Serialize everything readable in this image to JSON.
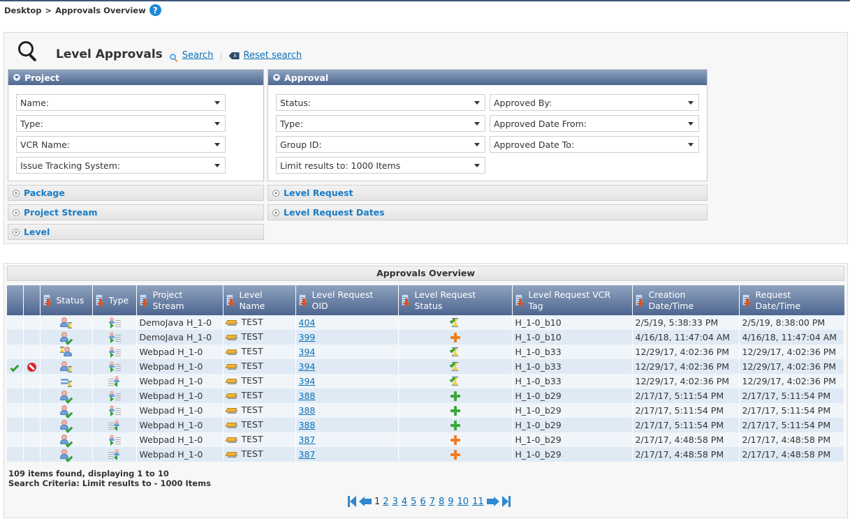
{
  "breadcrumb": {
    "root": "Desktop",
    "separator": ">",
    "current": "Approvals Overview"
  },
  "search": {
    "title": "Level Approvals",
    "search_link": "Search",
    "reset_link": "Reset search",
    "sections": {
      "project": {
        "title": "Project",
        "fields": [
          "Name:",
          "Type:",
          "VCR Name:",
          "Issue Tracking System:"
        ]
      },
      "approval": {
        "title": "Approval",
        "left_fields": [
          "Status:",
          "Type:",
          "Group ID:",
          "Limit results to: 1000 Items"
        ],
        "right_fields": [
          "Approved By:",
          "Approved Date From:",
          "Approved Date To:"
        ]
      },
      "collapsed": [
        "Package",
        "Level Request",
        "Project Stream",
        "Level Request Dates",
        "Level"
      ]
    }
  },
  "results": {
    "title": "Approvals Overview",
    "columns": [
      "",
      "",
      "Status",
      "Type",
      "Project Stream",
      "Level Name",
      "Level Request OID",
      "Level Request Status",
      "Level Request VCR Tag",
      "Creation Date/Time",
      "Request Date/Time"
    ],
    "rows": [
      {
        "actions": false,
        "status_icon": "pending",
        "type_icon": "request",
        "stream": "DemoJava H_1-0",
        "level": "TEST",
        "oid": "404",
        "lr_status_icon": "pending-approval",
        "tag": "H_1-0_b10",
        "created": "2/5/19, 5:38:33 PM",
        "requested": "2/5/19, 8:38:00 PM"
      },
      {
        "actions": false,
        "status_icon": "approved",
        "type_icon": "request",
        "stream": "DemoJava H_1-0",
        "level": "TEST",
        "oid": "399",
        "lr_status_icon": "orange-plus",
        "tag": "H_1-0_b10",
        "created": "4/16/18, 11:47:04 AM",
        "requested": "4/16/18, 11:47:04 AM"
      },
      {
        "actions": false,
        "status_icon": "group-pending",
        "type_icon": "request",
        "stream": "Webpad H_1-0",
        "level": "TEST",
        "oid": "394",
        "lr_status_icon": "pending-approval",
        "tag": "H_1-0_b33",
        "created": "12/29/17, 4:02:36 PM",
        "requested": "12/29/17, 4:02:36 PM"
      },
      {
        "actions": true,
        "status_icon": "pending",
        "type_icon": "request",
        "stream": "Webpad H_1-0",
        "level": "TEST",
        "oid": "394",
        "lr_status_icon": "pending-approval",
        "tag": "H_1-0_b33",
        "created": "12/29/17, 4:02:36 PM",
        "requested": "12/29/17, 4:02:36 PM"
      },
      {
        "actions": false,
        "status_icon": "queue-pending",
        "type_icon": "return",
        "stream": "Webpad H_1-0",
        "level": "TEST",
        "oid": "394",
        "lr_status_icon": "pending-approval",
        "tag": "H_1-0_b33",
        "created": "12/29/17, 4:02:36 PM",
        "requested": "12/29/17, 4:02:36 PM"
      },
      {
        "actions": false,
        "status_icon": "approved",
        "type_icon": "request",
        "stream": "Webpad H_1-0",
        "level": "TEST",
        "oid": "388",
        "lr_status_icon": "green-plus",
        "tag": "H_1-0_b29",
        "created": "2/17/17, 5:11:54 PM",
        "requested": "2/17/17, 5:11:54 PM"
      },
      {
        "actions": false,
        "status_icon": "approved",
        "type_icon": "request",
        "stream": "Webpad H_1-0",
        "level": "TEST",
        "oid": "388",
        "lr_status_icon": "green-plus",
        "tag": "H_1-0_b29",
        "created": "2/17/17, 5:11:54 PM",
        "requested": "2/17/17, 5:11:54 PM"
      },
      {
        "actions": false,
        "status_icon": "approved",
        "type_icon": "return",
        "stream": "Webpad H_1-0",
        "level": "TEST",
        "oid": "388",
        "lr_status_icon": "green-plus",
        "tag": "H_1-0_b29",
        "created": "2/17/17, 5:11:54 PM",
        "requested": "2/17/17, 5:11:54 PM"
      },
      {
        "actions": false,
        "status_icon": "approved",
        "type_icon": "request",
        "stream": "Webpad H_1-0",
        "level": "TEST",
        "oid": "387",
        "lr_status_icon": "orange-plus",
        "tag": "H_1-0_b29",
        "created": "2/17/17, 4:48:58 PM",
        "requested": "2/17/17, 4:48:58 PM"
      },
      {
        "actions": false,
        "status_icon": "approved",
        "type_icon": "return",
        "stream": "Webpad H_1-0",
        "level": "TEST",
        "oid": "387",
        "lr_status_icon": "orange-plus",
        "tag": "H_1-0_b29",
        "created": "2/17/17, 4:48:58 PM",
        "requested": "2/17/17, 4:48:58 PM"
      }
    ],
    "summary_line1": "109 items found, displaying 1 to 10",
    "summary_line2": "Search Criteria: Limit results to - 1000 Items",
    "pagination": {
      "current": "1",
      "pages": [
        "2",
        "3",
        "4",
        "5",
        "6",
        "7",
        "8",
        "9",
        "10",
        "11"
      ]
    }
  },
  "colors": {
    "header_top": "#8ea2bf",
    "header_bottom": "#4e6890",
    "link": "#0b6fb3",
    "row_odd": "#f0f5fa",
    "row_even": "#dfeaf5"
  }
}
